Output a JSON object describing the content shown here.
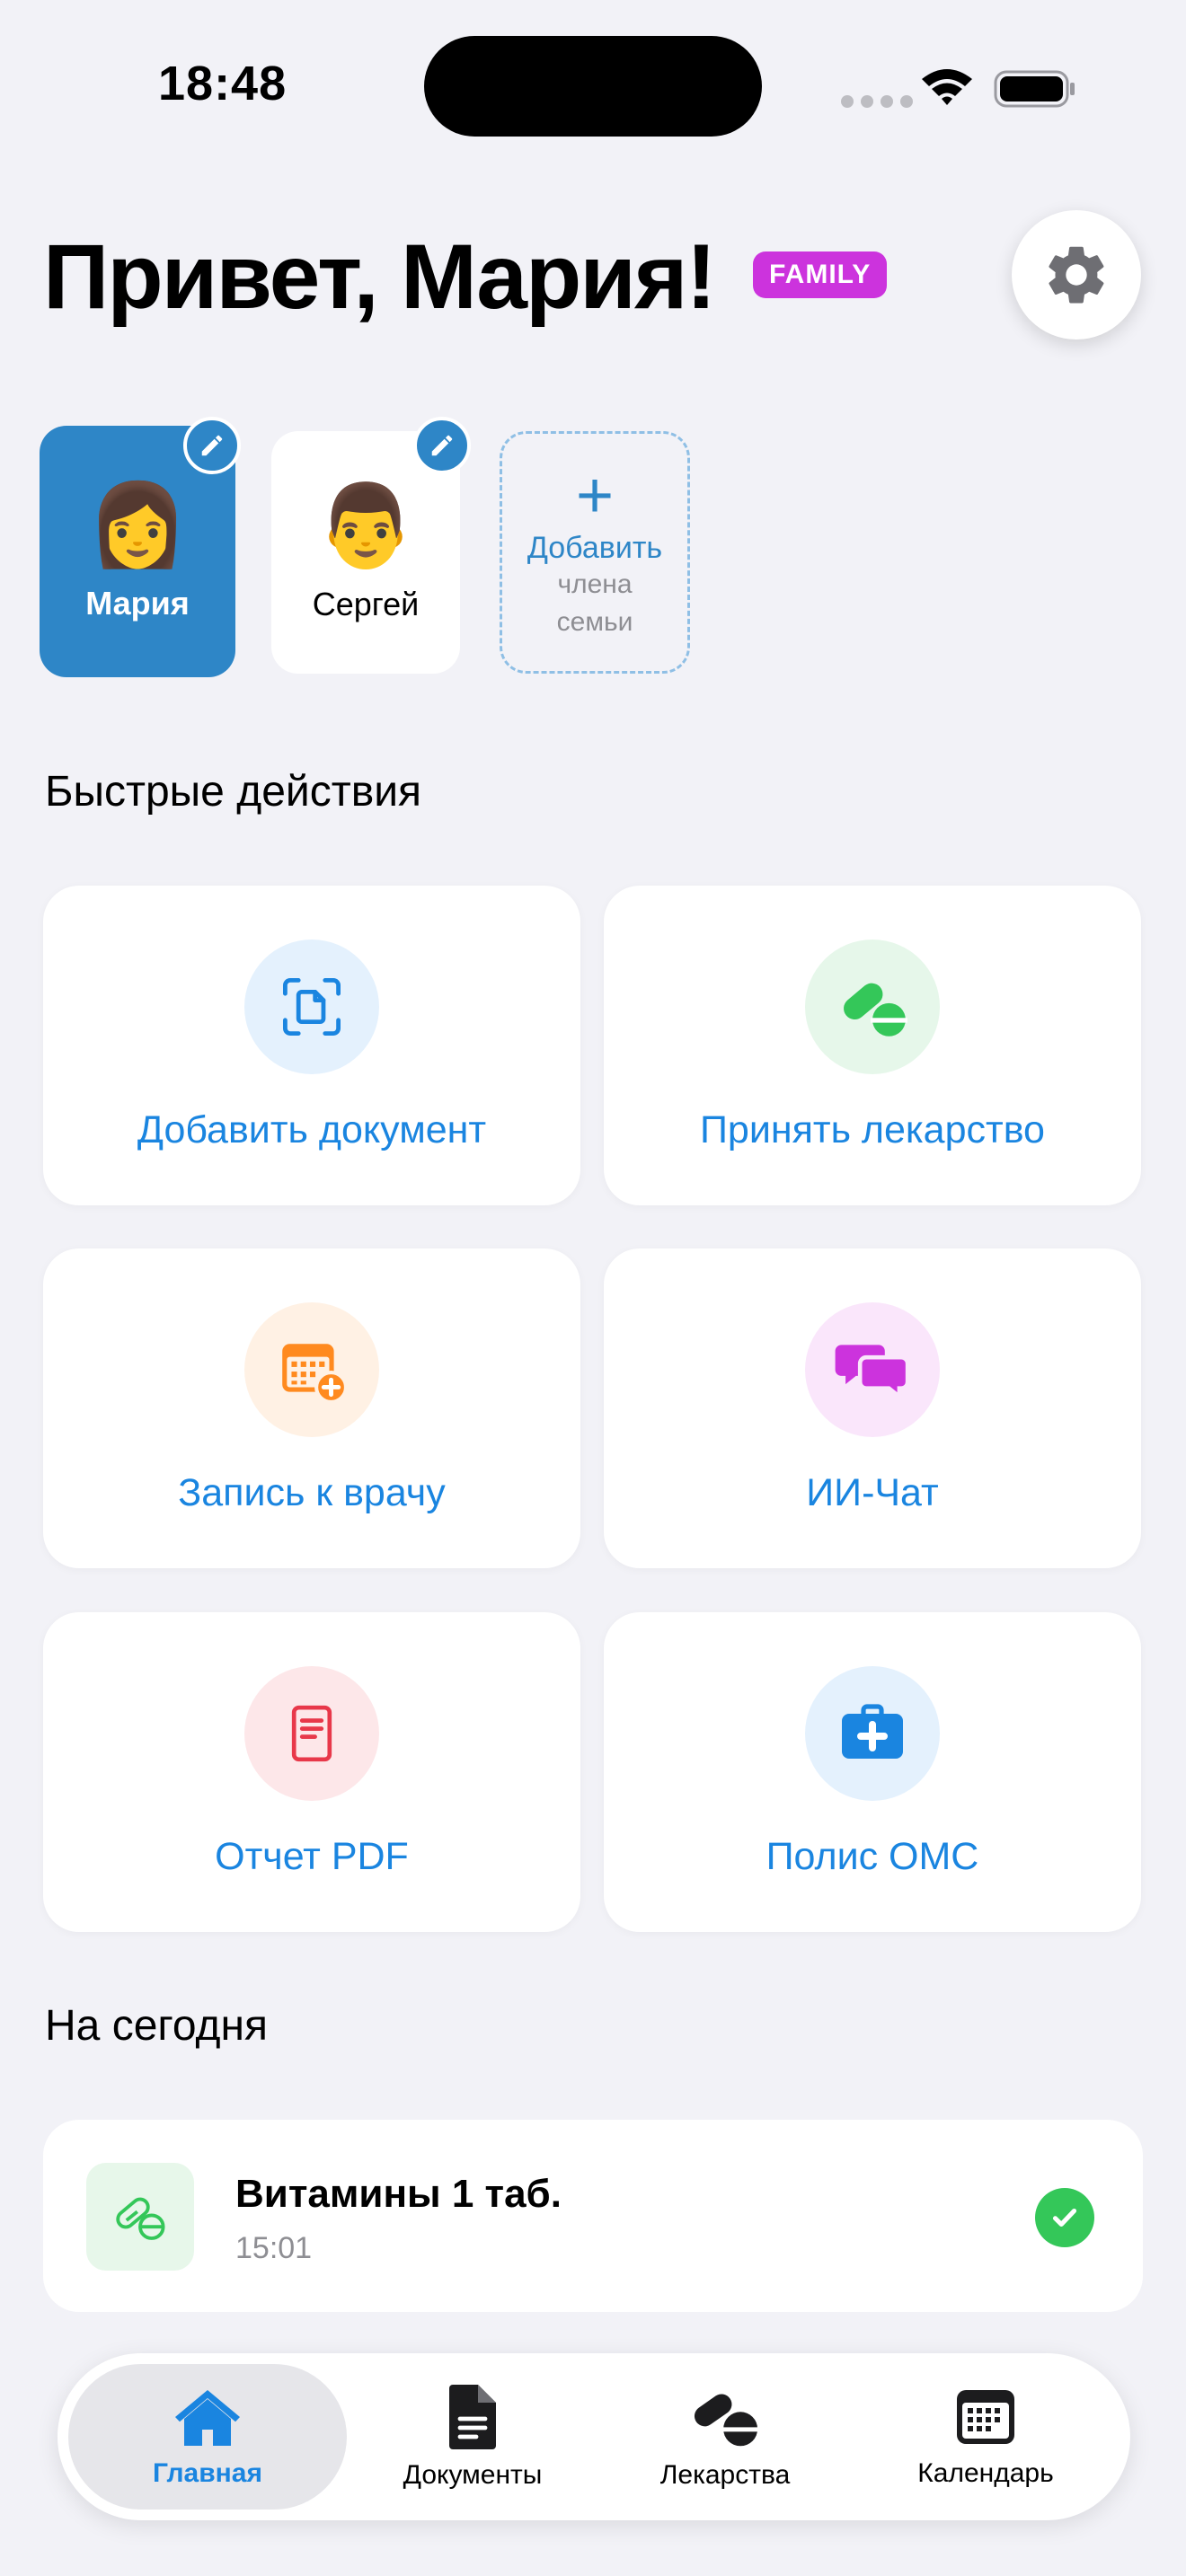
{
  "status_bar": {
    "time": "18:48"
  },
  "header": {
    "greeting": "Привет, Мария!",
    "badge": "FAMILY"
  },
  "members": [
    {
      "emoji": "👩",
      "name": "Мария"
    },
    {
      "emoji": "👨",
      "name": "Сергей"
    }
  ],
  "add_member": {
    "plus": "+",
    "line1": "Добавить",
    "line2": "члена",
    "line3": "семьи"
  },
  "quick_actions": {
    "title": "Быстрые действия",
    "items": [
      {
        "label": "Добавить документ",
        "icon": "doc-scan-icon",
        "color": "#1A85E0",
        "bg": "#E4F1FD"
      },
      {
        "label": "Принять лекарство",
        "icon": "pills-icon",
        "color": "#34C759",
        "bg": "#E6F7EA"
      },
      {
        "label": "Запись к врачу",
        "icon": "calendar-add-icon",
        "color": "#FF8A1F",
        "bg": "#FFF1E4"
      },
      {
        "label": "ИИ-Чат",
        "icon": "chat-bubbles-icon",
        "color": "#CC33DD",
        "bg": "#FAE6FB"
      },
      {
        "label": "Отчет PDF",
        "icon": "pdf-report-icon",
        "color": "#E8384A",
        "bg": "#FDE7E9"
      },
      {
        "label": "Полис ОМС",
        "icon": "medical-case-icon",
        "color": "#1A85E0",
        "bg": "#E4F1FD"
      }
    ]
  },
  "today": {
    "title": "На сегодня",
    "items": [
      {
        "title": "Витамины 1 таб.",
        "time": "15:01",
        "done": true
      }
    ]
  },
  "tab_bar": {
    "tabs": [
      {
        "label": "Главная",
        "icon": "home-icon",
        "active": true
      },
      {
        "label": "Документы",
        "icon": "document-icon",
        "active": false
      },
      {
        "label": "Лекарства",
        "icon": "pills-icon",
        "active": false
      },
      {
        "label": "Календарь",
        "icon": "calendar-icon",
        "active": false
      }
    ]
  },
  "colors": {
    "accent": "#1A85E0",
    "member_active": "#2E86C7",
    "background": "#F2F2F7",
    "badge": "#CC33DD",
    "success": "#34C759"
  }
}
